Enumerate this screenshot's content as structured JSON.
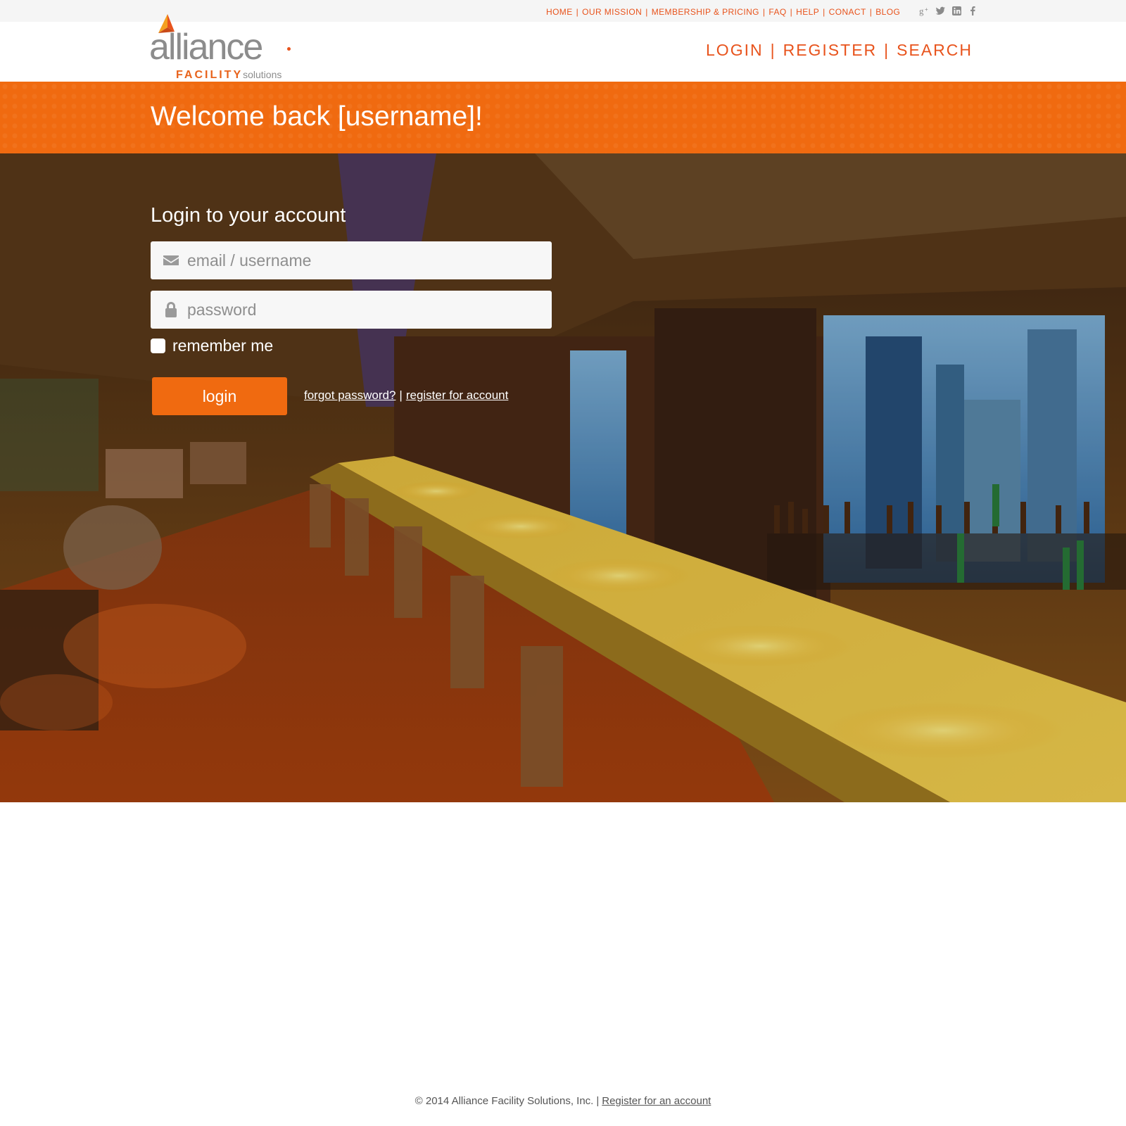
{
  "util_nav": {
    "items": [
      "HOME",
      "OUR MISSION",
      "MEMBERSHIP & PRICING",
      "FAQ",
      "HELP",
      "CONACT",
      "BLOG"
    ],
    "separator": "|"
  },
  "social": [
    "google-plus-icon",
    "twitter-icon",
    "linkedin-icon",
    "facebook-icon"
  ],
  "logo": {
    "word": "alliance",
    "sub_bold": "FACILITY",
    "sub_light": "solutions"
  },
  "main_nav": {
    "login": "LOGIN",
    "register": "REGISTER",
    "search": "SEARCH",
    "separator": "|"
  },
  "banner": {
    "welcome": "Welcome back [username]!"
  },
  "login_form": {
    "title": "Login to your account",
    "email_placeholder": "email / username",
    "password_placeholder": "password",
    "remember_label": "remember me",
    "login_button": "login",
    "forgot_link": "forgot password?",
    "link_separator": "|",
    "register_link": "register for account"
  },
  "footer": {
    "copyright": "© 2014 Alliance Facility Solutions, Inc.",
    "separator": "|",
    "register_link": "Register for an account"
  },
  "colors": {
    "accent": "#f06a10",
    "nav_text": "#e8531c",
    "logo_gray": "#8c8c8c"
  }
}
